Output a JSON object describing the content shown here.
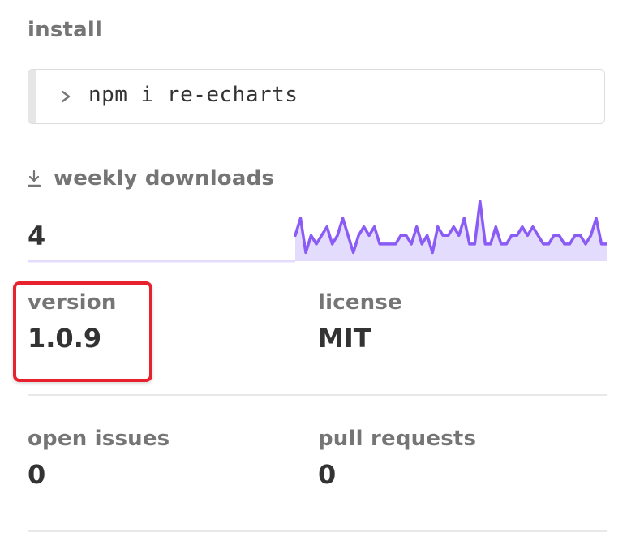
{
  "install": {
    "title": "install",
    "command": "npm i re-echarts",
    "prompt_icon": "terminal-prompt-icon"
  },
  "downloads": {
    "title": "weekly downloads",
    "icon": "download-icon",
    "value": "4",
    "line_color": "#8a5cf5",
    "fill_color": "#e4dcfc",
    "chart_data": {
      "type": "area",
      "series": [
        {
          "values": [
            3,
            5,
            1,
            3,
            2,
            3,
            4,
            2,
            3,
            5,
            3,
            1,
            3,
            4,
            3,
            4,
            2,
            2,
            2,
            2,
            3,
            3,
            2,
            4,
            2,
            3,
            1,
            4,
            3,
            3,
            4,
            3,
            5,
            2,
            2,
            7,
            2,
            2,
            4,
            2,
            2,
            3,
            3,
            4,
            3,
            4,
            3,
            2,
            2,
            3,
            3,
            2,
            2,
            3,
            3,
            2,
            3,
            5,
            2,
            2
          ]
        }
      ]
    }
  },
  "stats": {
    "version": {
      "label": "version",
      "value": "1.0.9"
    },
    "license": {
      "label": "license",
      "value": "MIT"
    },
    "issues": {
      "label": "open issues",
      "value": "0"
    },
    "pulls": {
      "label": "pull requests",
      "value": "0"
    }
  },
  "highlight_color": "#e8212f"
}
